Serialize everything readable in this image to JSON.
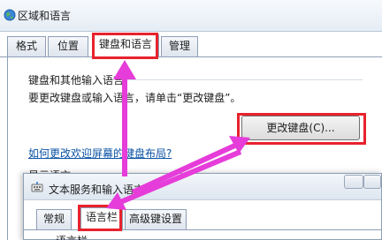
{
  "window": {
    "title": "区域和语言",
    "tabs": [
      "格式",
      "位置",
      "键盘和语言",
      "管理"
    ]
  },
  "keyboard_section": {
    "heading": "键盘和其他输入语言",
    "description": "要更改键盘或输入语言，请单击“更改键盘”。",
    "change_button": "更改键盘(C)...",
    "help_link": "如何更改欢迎屏幕的键盘布局?",
    "partial_heading": "显示语言"
  },
  "text_services_dialog": {
    "title": "文本服务和输入语言",
    "tabs": [
      "常规",
      "语言栏",
      "高级键设置"
    ],
    "partial_label": "语言栏"
  },
  "colors": {
    "highlight_box": "#e8222d",
    "arrow": "#e63cd9"
  }
}
